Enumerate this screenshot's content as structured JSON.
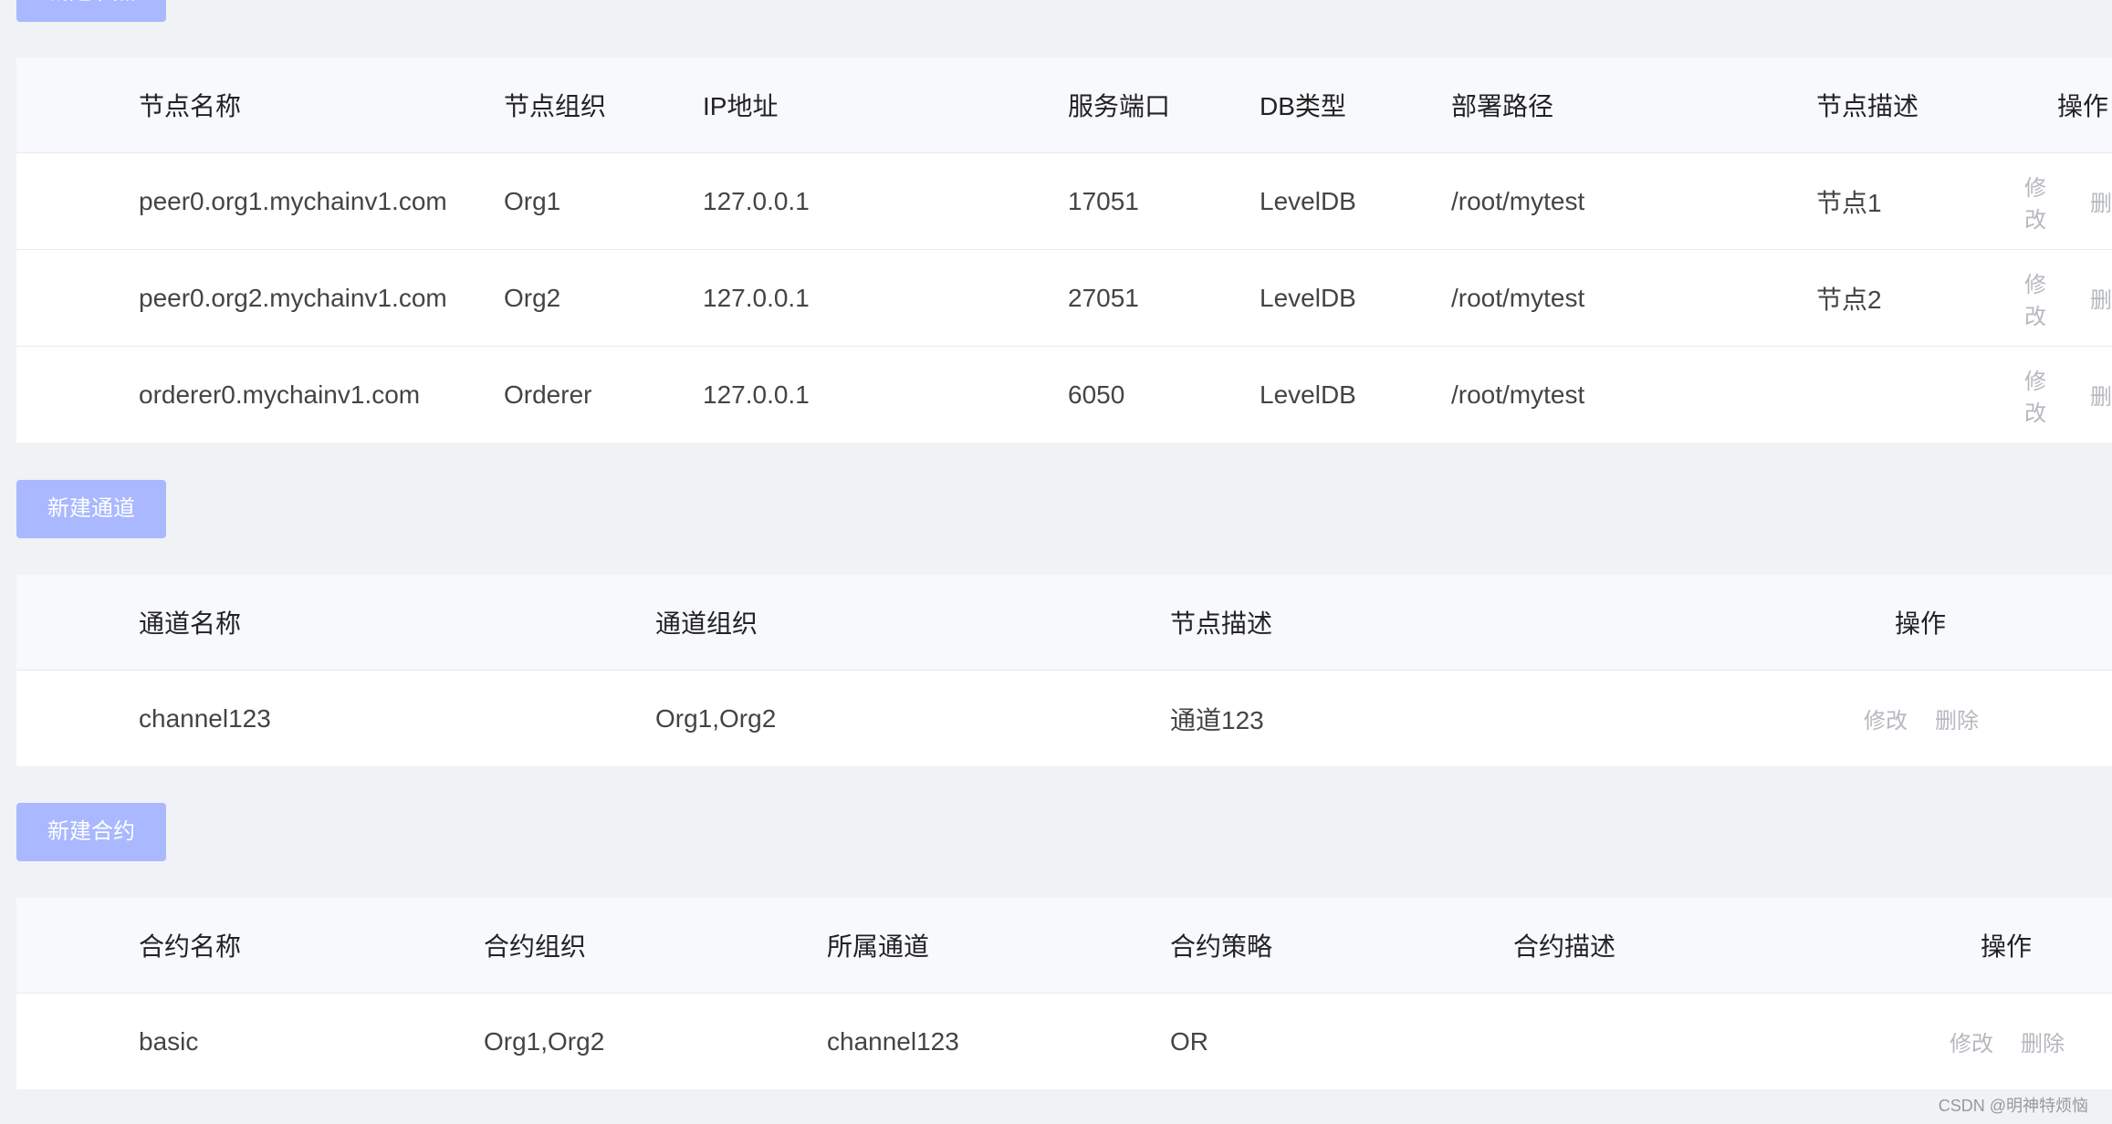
{
  "nodes": {
    "new_button": "新建节点",
    "headers": [
      "节点名称",
      "节点组织",
      "IP地址",
      "服务端口",
      "DB类型",
      "部署路径",
      "节点描述",
      "操作"
    ],
    "rows": [
      {
        "name": "peer0.org1.mychainv1.com",
        "org": "Org1",
        "ip": "127.0.0.1",
        "port": "17051",
        "db": "LevelDB",
        "path": "/root/mytest",
        "desc": "节点1"
      },
      {
        "name": "peer0.org2.mychainv1.com",
        "org": "Org2",
        "ip": "127.0.0.1",
        "port": "27051",
        "db": "LevelDB",
        "path": "/root/mytest",
        "desc": "节点2"
      },
      {
        "name": "orderer0.mychainv1.com",
        "org": "Orderer",
        "ip": "127.0.0.1",
        "port": "6050",
        "db": "LevelDB",
        "path": "/root/mytest",
        "desc": ""
      }
    ]
  },
  "channels": {
    "new_button": "新建通道",
    "headers": [
      "通道名称",
      "通道组织",
      "节点描述",
      "操作"
    ],
    "rows": [
      {
        "name": "channel123",
        "org": "Org1,Org2",
        "desc": "通道123"
      }
    ]
  },
  "contracts": {
    "new_button": "新建合约",
    "headers": [
      "合约名称",
      "合约组织",
      "所属通道",
      "合约策略",
      "合约描述",
      "操作"
    ],
    "rows": [
      {
        "name": "basic",
        "org": "Org1,Org2",
        "channel": "channel123",
        "policy": "OR",
        "desc": ""
      }
    ]
  },
  "actions": {
    "edit": "修改",
    "delete": "删除",
    "delete_clipped": "删"
  },
  "watermark": "CSDN @明神特烦恼",
  "colors": {
    "primary_button": "#a9b8ff",
    "background": "#f0f2f5",
    "header_bg": "#f7f9fd",
    "action_text": "#b5b8be"
  }
}
